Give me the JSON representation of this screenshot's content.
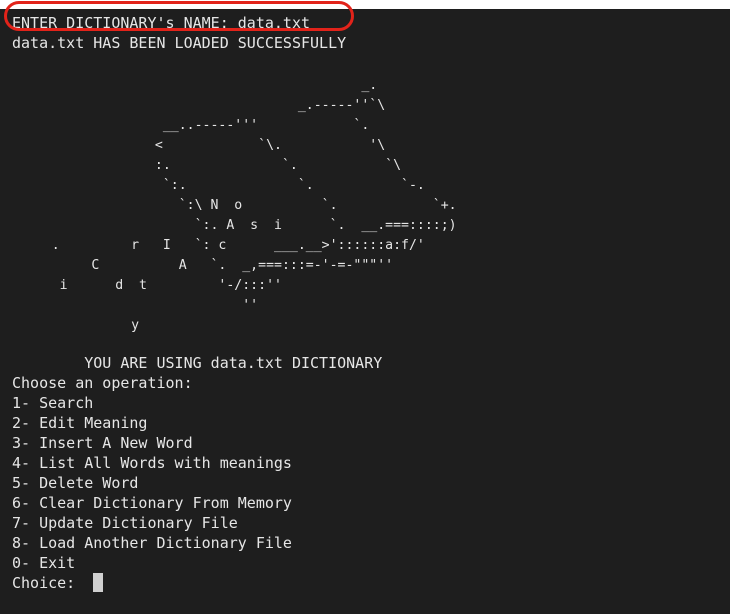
{
  "terminal": {
    "prompt_line": "ENTER DICTIONARY's NAME: data.txt",
    "loaded_line": "data.txt HAS BEEN LOADED SUCCESSFULLY",
    "ascii_art": "                                            _.\n                                    _.-----''`\\\n                   __..-----'''            `.\n                  <            `\\.           '\\\n                  :.              `.           `\\\n                   `:.              `.           `-.\n                     `:\\ N  o          `.            `+.\n                       `:. A  s  i      `.  __.===::::;)\n     .         r   I   `: c      ___.__>'::::::a:f/'\n          C          A   `.  _,===:::=-'-=-\"\"\"''\n      i      d  t         '-/:::''\n                             ''\n               y",
    "using_line": "        YOU ARE USING data.txt DICTIONARY",
    "menu_title": "Choose an operation:",
    "menu_items": [
      "1- Search",
      "2- Edit Meaning",
      "3- Insert A New Word",
      "4- List All Words with meanings",
      "5- Delete Word",
      "6- Clear Dictionary From Memory",
      "7- Update Dictionary File",
      "8- Load Another Dictionary File",
      "0- Exit"
    ],
    "choice_prompt": "Choice: "
  },
  "annotation": {
    "highlight_color": "#e2231a"
  },
  "colors": {
    "background": "#1e1e1e",
    "text": "#e6e6e6",
    "cursor": "#d0d0d0"
  }
}
